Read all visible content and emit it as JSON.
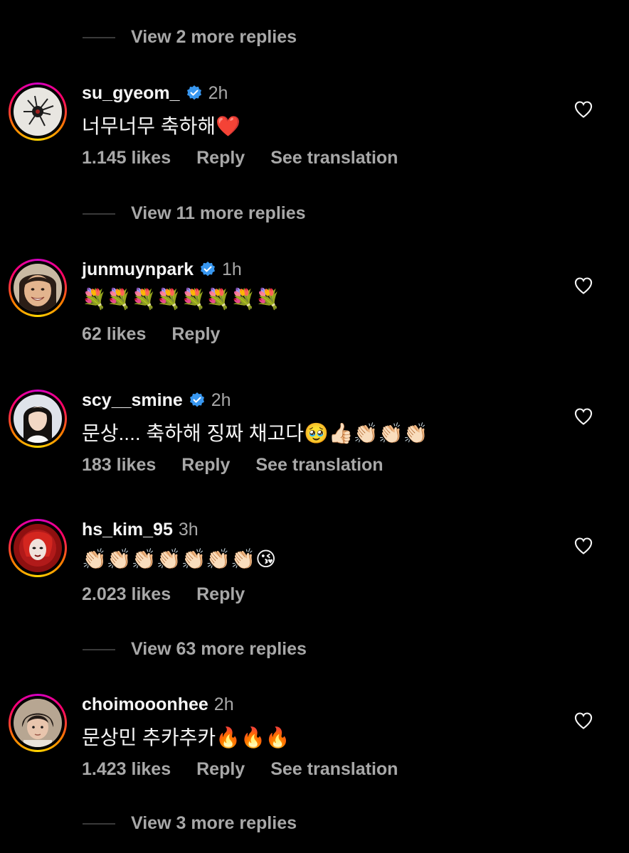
{
  "view_more": [
    {
      "label": "View 2 more replies"
    },
    {
      "label": "View 11 more replies"
    },
    {
      "label": "View 63 more replies"
    },
    {
      "label": "View 3 more replies"
    }
  ],
  "comments": [
    {
      "username": "su_gyeom_",
      "verified": true,
      "time": "2h",
      "text": "너무너무 축하해❤️",
      "likes": "1.145 likes",
      "reply": "Reply",
      "translate": "See translation"
    },
    {
      "username": "junmuynpark",
      "verified": true,
      "time": "1h",
      "text": "💐💐💐💐💐💐💐💐",
      "likes": "62 likes",
      "reply": "Reply"
    },
    {
      "username": "scy__smine",
      "verified": true,
      "time": "2h",
      "text": "문상.... 축하해 징짜 채고다🥹👍🏻👏🏻👏🏻👏🏻",
      "likes": "183 likes",
      "reply": "Reply",
      "translate": "See translation"
    },
    {
      "username": "hs_kim_95",
      "verified": false,
      "time": "3h",
      "text": "👏🏻👏🏻👏🏻👏🏻👏🏻👏🏻👏🏻😘",
      "likes": "2.023 likes",
      "reply": "Reply"
    },
    {
      "username": "choimooonhee",
      "verified": false,
      "time": "2h",
      "text": "문상민 추카추카🔥🔥🔥",
      "likes": "1.423 likes",
      "reply": "Reply",
      "translate": "See translation"
    }
  ],
  "colors": {
    "background": "#000000",
    "primary_text": "#f5f5f5",
    "secondary_text": "#a8a8a8",
    "verified_blue": "#3897f0",
    "divider": "#3a3a3a"
  }
}
